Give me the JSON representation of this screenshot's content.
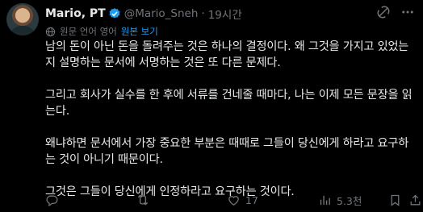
{
  "author": {
    "name": "Mario, PT",
    "handle": "@Mario_Sneh",
    "separator": "·",
    "time": "19시간"
  },
  "translation": {
    "label": "원문 언어 영어",
    "link": "원본 보기"
  },
  "paragraphs": [
    "남의 돈이 아닌 돈을 돌려주는 것은 하나의 결정이다. 왜 그것을 가지고 있었는\n지 설명하는 문서에 서명하는 것은 또 다른 문제다.",
    "그리고 회사가 실수를 한 후에 서류를 건네줄 때마다, 나는 이제 모든 문장을 읽\n는다.",
    "왜냐하면 문서에서 가장 중요한 부분은 때때로 그들이 당신에게 하라고 요구하\n는 것이 아니기 때문이다.",
    "그것은 그들이 당신에게 인정하라고 요구하는 것이다."
  ],
  "stats": {
    "likes": "17",
    "views": "5.3천"
  },
  "colors": {
    "background": "#000000",
    "text": "#e7e9ea",
    "muted": "#71767b",
    "accent": "#1d9bf0"
  },
  "icons": [
    "verified-badge-icon",
    "grok-icon",
    "more-icon",
    "globe-icon",
    "reply-icon",
    "retweet-icon",
    "like-icon",
    "views-icon",
    "bookmark-icon",
    "share-icon"
  ]
}
